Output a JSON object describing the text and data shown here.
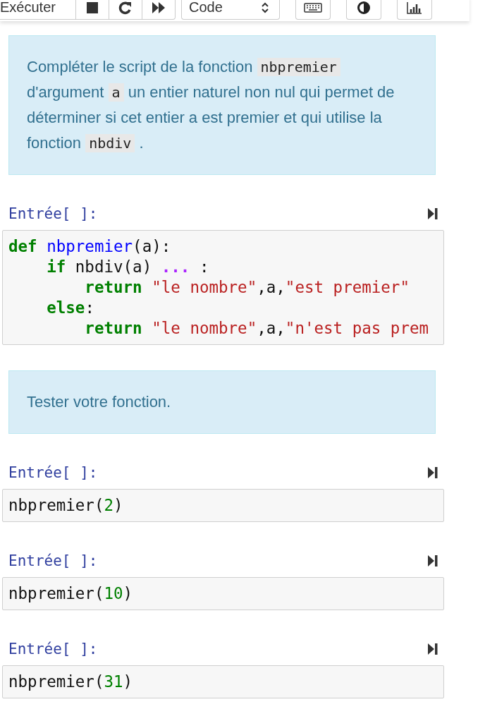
{
  "toolbar": {
    "run_label": "Exécuter",
    "cell_type": "Code"
  },
  "cells": [
    {
      "kind": "markdown",
      "parts": [
        {
          "kind": "text",
          "text": "Compléter le script de la fonction "
        },
        {
          "kind": "code",
          "text": "nbpremier"
        },
        {
          "kind": "text",
          "text": " d'argument "
        },
        {
          "kind": "code",
          "text": "a"
        },
        {
          "kind": "text",
          "text": " un entier naturel non nul qui permet de déterminer si cet entier a est premier et qui utilise la fonction "
        },
        {
          "kind": "code",
          "text": "nbdiv"
        },
        {
          "kind": "text",
          "text": " ."
        }
      ]
    },
    {
      "kind": "code",
      "prompt": "Entrée[ ]:",
      "lines": [
        [
          {
            "kind": "keyword",
            "text": "def "
          },
          {
            "kind": "defname",
            "text": "nbpremier"
          },
          {
            "kind": "plain",
            "text": "(a):"
          }
        ],
        [
          {
            "kind": "keyword",
            "text": "    if"
          },
          {
            "kind": "plain",
            "text": " nbdiv(a) "
          },
          {
            "kind": "ellipsis",
            "text": "..."
          },
          {
            "kind": "plain",
            "text": " :"
          }
        ],
        [
          {
            "kind": "keyword",
            "text": "        return "
          },
          {
            "kind": "string",
            "text": "\"le nombre\""
          },
          {
            "kind": "plain",
            "text": ",a,"
          },
          {
            "kind": "string",
            "text": "\"est premier\""
          }
        ],
        [
          {
            "kind": "keyword",
            "text": "    else"
          },
          {
            "kind": "plain",
            "text": ":"
          }
        ],
        [
          {
            "kind": "keyword",
            "text": "        return "
          },
          {
            "kind": "string",
            "text": "\"le nombre\""
          },
          {
            "kind": "plain",
            "text": ",a,"
          },
          {
            "kind": "string",
            "text": "\"n'est pas prem"
          }
        ]
      ]
    },
    {
      "kind": "markdown",
      "parts": [
        {
          "kind": "text",
          "text": "Tester votre fonction."
        }
      ]
    },
    {
      "kind": "code",
      "prompt": "Entrée[ ]:",
      "lines": [
        [
          {
            "kind": "plain",
            "text": "nbpremier("
          },
          {
            "kind": "number",
            "text": "2"
          },
          {
            "kind": "plain",
            "text": ")"
          }
        ]
      ]
    },
    {
      "kind": "code",
      "prompt": "Entrée[ ]:",
      "lines": [
        [
          {
            "kind": "plain",
            "text": "nbpremier("
          },
          {
            "kind": "number",
            "text": "10"
          },
          {
            "kind": "plain",
            "text": ")"
          }
        ]
      ]
    },
    {
      "kind": "code",
      "prompt": "Entrée[ ]:",
      "lines": [
        [
          {
            "kind": "plain",
            "text": "nbpremier("
          },
          {
            "kind": "number",
            "text": "31"
          },
          {
            "kind": "plain",
            "text": ")"
          }
        ]
      ]
    }
  ]
}
